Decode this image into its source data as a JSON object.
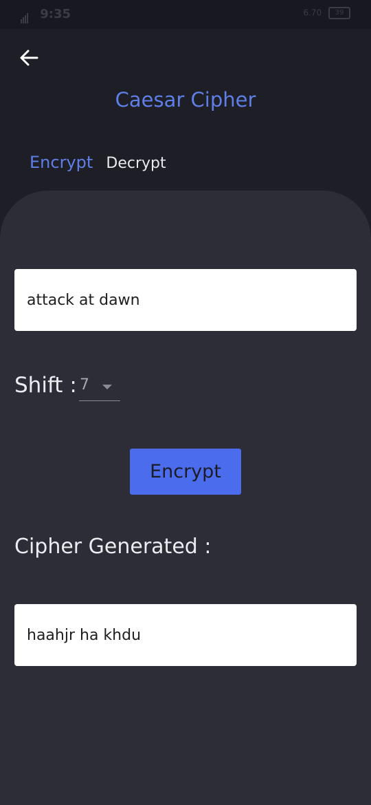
{
  "status_bar": {
    "time": "9:35",
    "net_speed": "6.70",
    "battery": "39"
  },
  "header": {
    "title": "Caesar Cipher"
  },
  "tabs": [
    {
      "label": "Encrypt",
      "active": true
    },
    {
      "label": "Decrypt",
      "active": false
    }
  ],
  "form": {
    "plaintext_value": "attack at dawn",
    "shift_label": "Shift :",
    "shift_value": "7",
    "encrypt_button_label": "Encrypt",
    "cipher_label": "Cipher Generated :",
    "cipher_value": "haahjr ha khdu"
  },
  "colors": {
    "accent": "#5f7ee6",
    "button": "#4a6ced",
    "background": "#1d1e26",
    "panel": "#2c2d37"
  },
  "icons": {
    "back": "arrow-left-icon",
    "dropdown": "caret-down-icon"
  }
}
